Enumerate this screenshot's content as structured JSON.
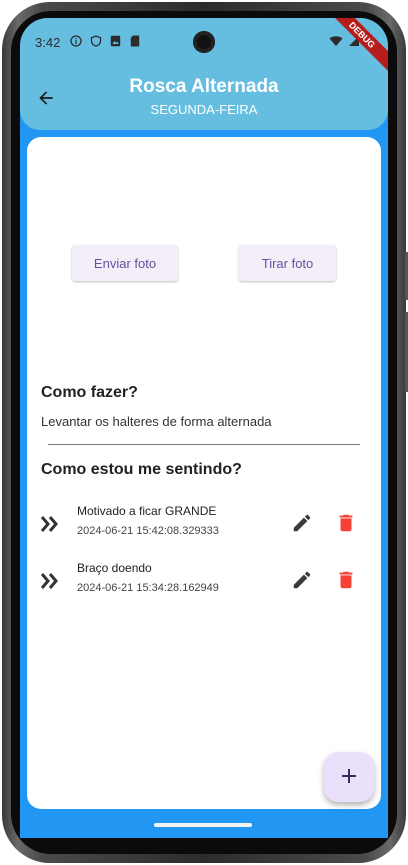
{
  "status_bar": {
    "time": "3:42",
    "debug_label": "DEBUG"
  },
  "app_bar": {
    "title": "Rosca Alternada",
    "subtitle": "SEGUNDA-FEIRA"
  },
  "photo_actions": {
    "send_photo": "Enviar foto",
    "take_photo": "Tirar foto"
  },
  "how_to": {
    "heading": "Como fazer?",
    "text": "Levantar os halteres de forma alternada"
  },
  "feelings": {
    "heading": "Como estou me sentindo?",
    "items": [
      {
        "title": "Motivado a ficar GRANDE",
        "date": "2024-06-21 15:42:08.329333"
      },
      {
        "title": "Braço doendo",
        "date": "2024-06-21 15:34:28.162949"
      }
    ]
  },
  "icons": {
    "back": "arrow-back-icon",
    "item": "double-chevron-right-icon",
    "edit": "pencil-icon",
    "delete": "trash-icon",
    "fab": "plus-icon"
  },
  "colors": {
    "app_bar": "#65bde0",
    "background": "#2196f3",
    "delete": "#f44336",
    "button_text": "#6a4ea0",
    "fab": "#ebe0fb"
  }
}
